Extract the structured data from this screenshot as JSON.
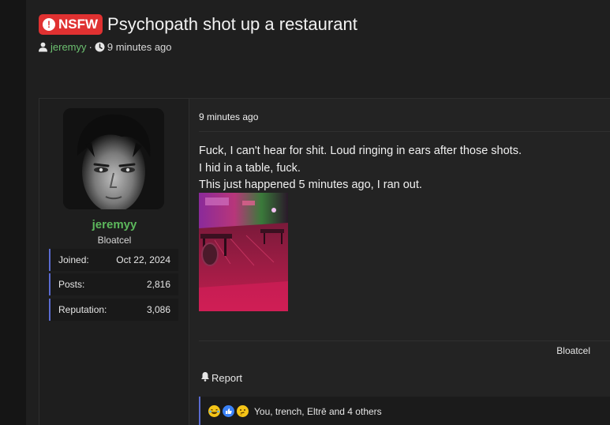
{
  "thread": {
    "badge": "NSFW",
    "badge_icon": "!",
    "title": "Psychopath shot up a restaurant",
    "author": "jeremyy",
    "separator": "·",
    "posted_ago": "9 minutes ago"
  },
  "post": {
    "time": "9 minutes ago",
    "lines": [
      "Fuck, I can't hear for shit. Loud ringing in ears after those shots.",
      "I hid in a table, fuck.",
      "This just happened 5 minutes ago, I ran out."
    ],
    "signature": "Bloatcel",
    "report_label": "Report"
  },
  "user": {
    "name": "jeremyy",
    "title": "Bloatcel",
    "stats": [
      {
        "label": "Joined:",
        "value": "Oct 22, 2024"
      },
      {
        "label": "Posts:",
        "value": "2,816"
      },
      {
        "label": "Reputation:",
        "value": "3,086"
      }
    ]
  },
  "reactions": {
    "icons": [
      "laughing-face",
      "thumbs-up",
      "thinking-face"
    ],
    "text": "You, trench, Eltrē and 4 others"
  },
  "colors": {
    "nsfw": "#e03131",
    "username": "#5cb85c",
    "accent_bar": "#5a6bd0",
    "author_link": "#6cc070"
  }
}
